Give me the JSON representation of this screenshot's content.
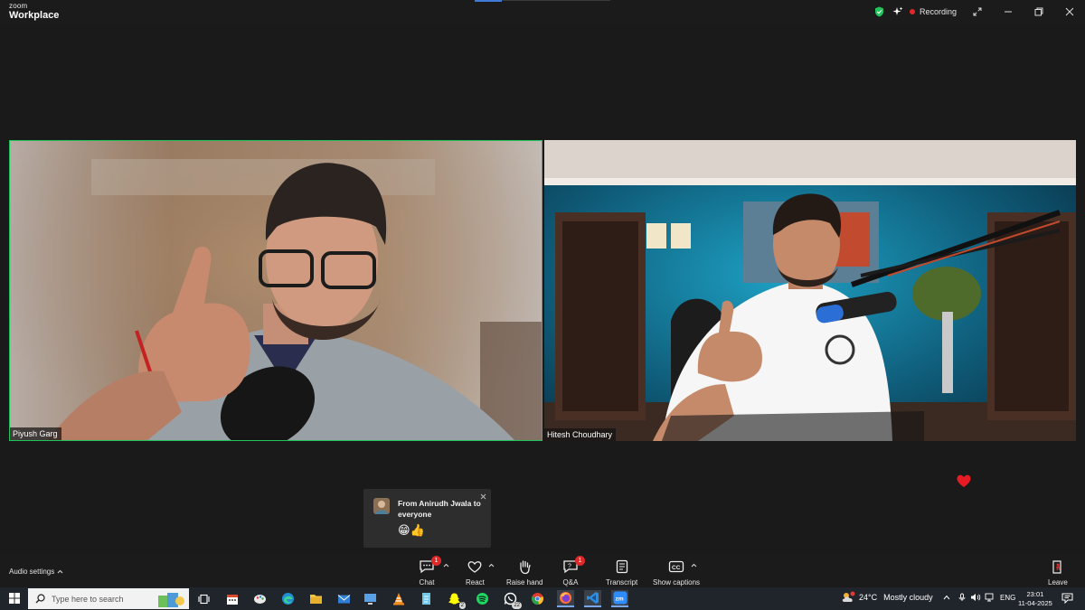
{
  "window": {
    "logo_top": "zoom",
    "logo_bottom": "Workplace",
    "recording_label": "Recording",
    "security_color": "#21c45a"
  },
  "participants": [
    {
      "name": "Piyush Garg",
      "active_speaker": true
    },
    {
      "name": "Hitesh Choudhary",
      "active_speaker": false
    }
  ],
  "chat_toast": {
    "from": "From Anirudh Jwala to everyone",
    "message": "😁👍"
  },
  "reaction_icon": "heart-icon",
  "toolbar": {
    "audio_settings": "Audio settings",
    "chat": {
      "label": "Chat",
      "badge": "1"
    },
    "react": {
      "label": "React"
    },
    "raise_hand": {
      "label": "Raise hand"
    },
    "qa": {
      "label": "Q&A",
      "badge": "1"
    },
    "transcript": {
      "label": "Transcript"
    },
    "captions": {
      "label": "Show captions"
    },
    "leave": {
      "label": "Leave"
    }
  },
  "taskbar": {
    "search_placeholder": "Type here to search",
    "app_badges": {
      "snapchat": "2",
      "whatsapp": "22"
    },
    "weather_temp": "24°C",
    "weather_condition": "Mostly cloudy",
    "language": "ENG",
    "time": "23:01",
    "date": "11-04-2025"
  }
}
